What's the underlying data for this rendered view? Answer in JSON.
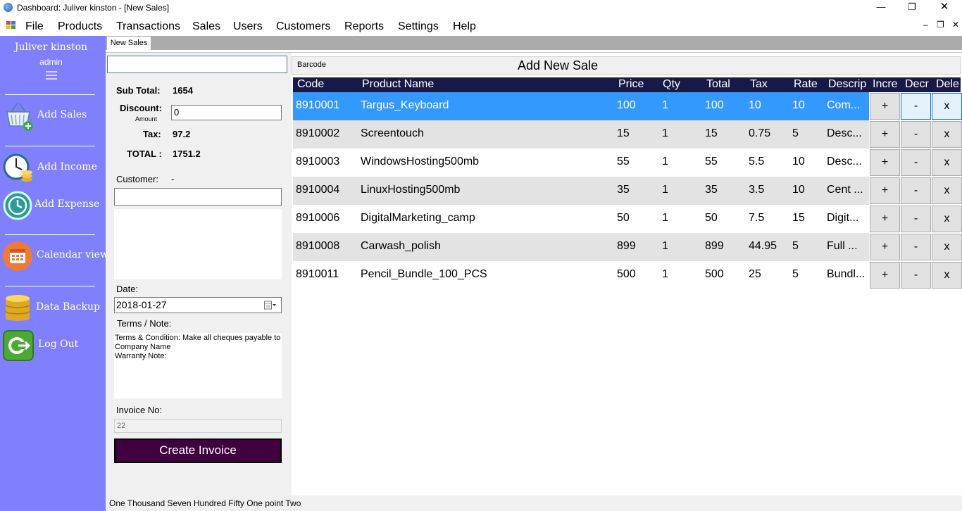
{
  "window": {
    "title": "Dashboard: Juliver kinston - [New Sales]",
    "minimize": "—",
    "restore": "❐",
    "close": "✕"
  },
  "menu": {
    "items": [
      "File",
      "Products",
      "Transactions",
      "Sales",
      "Users",
      "Customers",
      "Reports",
      "Settings",
      "Help"
    ],
    "mdi_min": "–",
    "mdi_restore": "❐",
    "mdi_close": "✕"
  },
  "sidebar": {
    "user_name": "Juliver kinston",
    "user_role": "admin",
    "items": [
      {
        "label": "Add Sales",
        "icon": "basket-icon"
      },
      {
        "label": "Add Income",
        "icon": "clock-coins-icon"
      },
      {
        "label": "Add Expense",
        "icon": "history-icon"
      },
      {
        "label": "Calendar view",
        "icon": "calendar-icon"
      },
      {
        "label": "Data Backup",
        "icon": "database-icon"
      },
      {
        "label": "Log Out",
        "icon": "logout-icon"
      }
    ],
    "colors": {
      "background": "#8080ff"
    }
  },
  "tabs": [
    "New Sales"
  ],
  "summary": {
    "subtotal_label": "Sub Total:",
    "subtotal_value": "1654",
    "discount_label": "Discount:",
    "discount_sub": "Amount",
    "discount_value": "0",
    "tax_label": "Tax:",
    "tax_value": "97.2",
    "total_label": "TOTAL :",
    "total_value": "1751.2",
    "customer_label": "Customer:",
    "customer_value": "-",
    "date_label": "Date:",
    "date_value": "2018-01-27",
    "terms_label": "Terms / Note:",
    "terms_text": "Terms & Condition: Make all cheques payable to\nCompany Name\nWarranty Note:",
    "invoice_label": "Invoice No:",
    "invoice_value": "22",
    "create_button": "Create Invoice"
  },
  "sale": {
    "barcode_label": "Barcode",
    "title": "Add New Sale",
    "columns": [
      "Code",
      "Product Name",
      "Price",
      "Qty",
      "Total",
      "Tax",
      "Rate",
      "Descrip",
      "Incre",
      "Decr",
      "Dele"
    ],
    "rows": [
      {
        "code": "8910001",
        "name": "Targus_Keyboard",
        "price": "100",
        "qty": "1",
        "total": "100",
        "tax": "10",
        "rate": "10",
        "desc": "Com...",
        "selected": true
      },
      {
        "code": "8910002",
        "name": "Screentouch",
        "price": "15",
        "qty": "1",
        "total": "15",
        "tax": "0.75",
        "rate": "5",
        "desc": "Desc..."
      },
      {
        "code": "8910003",
        "name": "WindowsHosting500mb",
        "price": "55",
        "qty": "1",
        "total": "55",
        "tax": "5.5",
        "rate": "10",
        "desc": "Desc..."
      },
      {
        "code": "8910004",
        "name": "LinuxHosting500mb",
        "price": "35",
        "qty": "1",
        "total": "35",
        "tax": "3.5",
        "rate": "10",
        "desc": "Cent ..."
      },
      {
        "code": "8910006",
        "name": "DigitalMarketing_camp",
        "price": "50",
        "qty": "1",
        "total": "50",
        "tax": "7.5",
        "rate": "15",
        "desc": "Digit..."
      },
      {
        "code": "8910008",
        "name": "Carwash_polish",
        "price": "899",
        "qty": "1",
        "total": "899",
        "tax": "44.95",
        "rate": "5",
        "desc": "Full ..."
      },
      {
        "code": "8910011",
        "name": "Pencil_Bundle_100_PCS",
        "price": "500",
        "qty": "1",
        "total": "500",
        "tax": "25",
        "rate": "5",
        "desc": "Bundl..."
      }
    ],
    "inc_label": "+",
    "dec_label": "-",
    "del_label": "x",
    "colors": {
      "header": "#191947",
      "selected": "#3399ff",
      "alt_row": "#e3e3e3",
      "row": "#ffffff"
    }
  },
  "status": {
    "amount_words": "One Thousand Seven Hundred Fifty One point Two"
  }
}
